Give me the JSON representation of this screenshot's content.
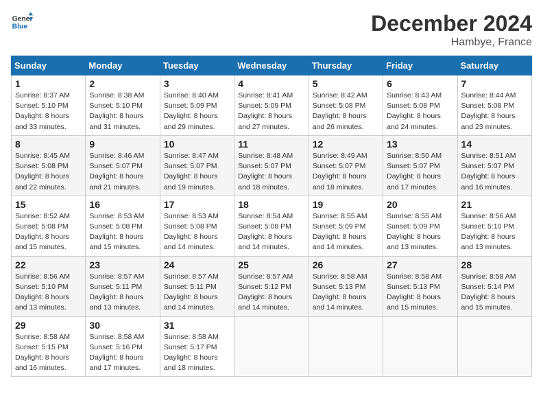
{
  "header": {
    "logo_line1": "General",
    "logo_line2": "Blue",
    "month": "December 2024",
    "location": "Hambye, France"
  },
  "weekdays": [
    "Sunday",
    "Monday",
    "Tuesday",
    "Wednesday",
    "Thursday",
    "Friday",
    "Saturday"
  ],
  "weeks": [
    [
      {
        "day": "1",
        "sunrise": "8:37 AM",
        "sunset": "5:10 PM",
        "daylight": "8 hours and 33 minutes."
      },
      {
        "day": "2",
        "sunrise": "8:38 AM",
        "sunset": "5:10 PM",
        "daylight": "8 hours and 31 minutes."
      },
      {
        "day": "3",
        "sunrise": "8:40 AM",
        "sunset": "5:09 PM",
        "daylight": "8 hours and 29 minutes."
      },
      {
        "day": "4",
        "sunrise": "8:41 AM",
        "sunset": "5:09 PM",
        "daylight": "8 hours and 27 minutes."
      },
      {
        "day": "5",
        "sunrise": "8:42 AM",
        "sunset": "5:08 PM",
        "daylight": "8 hours and 26 minutes."
      },
      {
        "day": "6",
        "sunrise": "8:43 AM",
        "sunset": "5:08 PM",
        "daylight": "8 hours and 24 minutes."
      },
      {
        "day": "7",
        "sunrise": "8:44 AM",
        "sunset": "5:08 PM",
        "daylight": "8 hours and 23 minutes."
      }
    ],
    [
      {
        "day": "8",
        "sunrise": "8:45 AM",
        "sunset": "5:08 PM",
        "daylight": "8 hours and 22 minutes."
      },
      {
        "day": "9",
        "sunrise": "8:46 AM",
        "sunset": "5:07 PM",
        "daylight": "8 hours and 21 minutes."
      },
      {
        "day": "10",
        "sunrise": "8:47 AM",
        "sunset": "5:07 PM",
        "daylight": "8 hours and 19 minutes."
      },
      {
        "day": "11",
        "sunrise": "8:48 AM",
        "sunset": "5:07 PM",
        "daylight": "8 hours and 18 minutes."
      },
      {
        "day": "12",
        "sunrise": "8:49 AM",
        "sunset": "5:07 PM",
        "daylight": "8 hours and 18 minutes."
      },
      {
        "day": "13",
        "sunrise": "8:50 AM",
        "sunset": "5:07 PM",
        "daylight": "8 hours and 17 minutes."
      },
      {
        "day": "14",
        "sunrise": "8:51 AM",
        "sunset": "5:07 PM",
        "daylight": "8 hours and 16 minutes."
      }
    ],
    [
      {
        "day": "15",
        "sunrise": "8:52 AM",
        "sunset": "5:08 PM",
        "daylight": "8 hours and 15 minutes."
      },
      {
        "day": "16",
        "sunrise": "8:53 AM",
        "sunset": "5:08 PM",
        "daylight": "8 hours and 15 minutes."
      },
      {
        "day": "17",
        "sunrise": "8:53 AM",
        "sunset": "5:08 PM",
        "daylight": "8 hours and 14 minutes."
      },
      {
        "day": "18",
        "sunrise": "8:54 AM",
        "sunset": "5:08 PM",
        "daylight": "8 hours and 14 minutes."
      },
      {
        "day": "19",
        "sunrise": "8:55 AM",
        "sunset": "5:09 PM",
        "daylight": "8 hours and 14 minutes."
      },
      {
        "day": "20",
        "sunrise": "8:55 AM",
        "sunset": "5:09 PM",
        "daylight": "8 hours and 13 minutes."
      },
      {
        "day": "21",
        "sunrise": "8:56 AM",
        "sunset": "5:10 PM",
        "daylight": "8 hours and 13 minutes."
      }
    ],
    [
      {
        "day": "22",
        "sunrise": "8:56 AM",
        "sunset": "5:10 PM",
        "daylight": "8 hours and 13 minutes."
      },
      {
        "day": "23",
        "sunrise": "8:57 AM",
        "sunset": "5:11 PM",
        "daylight": "8 hours and 13 minutes."
      },
      {
        "day": "24",
        "sunrise": "8:57 AM",
        "sunset": "5:11 PM",
        "daylight": "8 hours and 14 minutes."
      },
      {
        "day": "25",
        "sunrise": "8:57 AM",
        "sunset": "5:12 PM",
        "daylight": "8 hours and 14 minutes."
      },
      {
        "day": "26",
        "sunrise": "8:58 AM",
        "sunset": "5:13 PM",
        "daylight": "8 hours and 14 minutes."
      },
      {
        "day": "27",
        "sunrise": "8:58 AM",
        "sunset": "5:13 PM",
        "daylight": "8 hours and 15 minutes."
      },
      {
        "day": "28",
        "sunrise": "8:58 AM",
        "sunset": "5:14 PM",
        "daylight": "8 hours and 15 minutes."
      }
    ],
    [
      {
        "day": "29",
        "sunrise": "8:58 AM",
        "sunset": "5:15 PM",
        "daylight": "8 hours and 16 minutes."
      },
      {
        "day": "30",
        "sunrise": "8:58 AM",
        "sunset": "5:16 PM",
        "daylight": "8 hours and 17 minutes."
      },
      {
        "day": "31",
        "sunrise": "8:58 AM",
        "sunset": "5:17 PM",
        "daylight": "8 hours and 18 minutes."
      },
      null,
      null,
      null,
      null
    ]
  ],
  "labels": {
    "sunrise": "Sunrise:",
    "sunset": "Sunset:",
    "daylight": "Daylight:"
  }
}
